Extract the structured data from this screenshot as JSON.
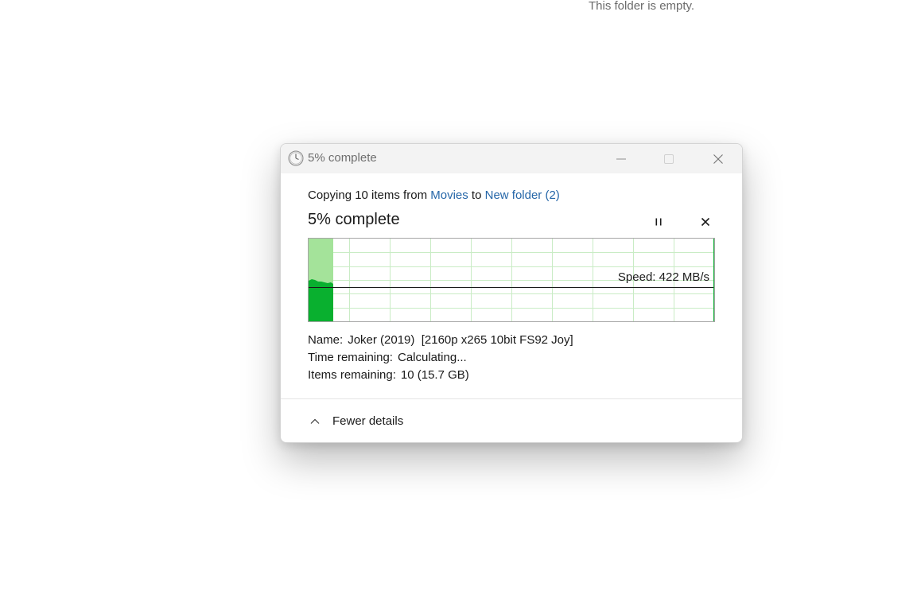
{
  "background": {
    "empty_folder_text": "This folder is empty."
  },
  "dialog": {
    "title": "5% complete",
    "copy_prefix": "Copying 10 items from",
    "source_folder": "Movies",
    "to_word": "to",
    "destination_folder": "New folder (2)",
    "headline": "5% complete",
    "progress_percent": 5,
    "speed_text": "Speed: 422 MB/s",
    "details": {
      "name_label": "Name:",
      "name_value": "Joker (2019)  [2160p x265 10bit FS92 Joy]",
      "time_label": "Time remaining:",
      "time_value": "Calculating...",
      "items_label": "Items remaining:",
      "items_value": "10 (15.7 GB)"
    },
    "fewer_details_label": "Fewer details",
    "colors": {
      "link": "#2566a8",
      "graph_fill_light": "#a4e39a",
      "graph_fill_dark": "#09b02f",
      "graph_grid": "#c9ecc5"
    }
  }
}
